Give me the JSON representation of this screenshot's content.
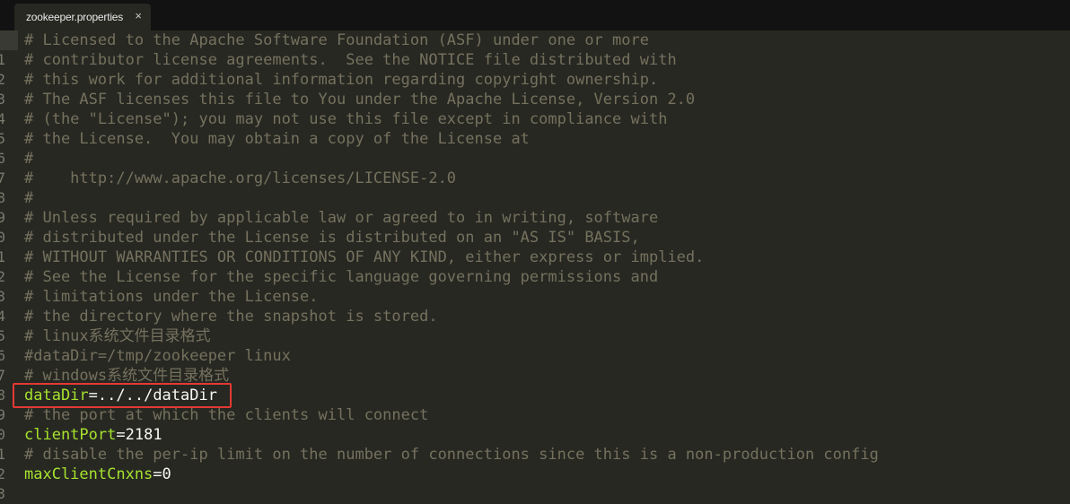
{
  "tab": {
    "title": "zookeeper.properties",
    "close_symbol": "×"
  },
  "colors": {
    "comment": "#75715e",
    "key": "#a6e22e",
    "value": "#f8f8f2",
    "highlight": "#e53935"
  },
  "lines": [
    {
      "type": "comment",
      "text": "# Licensed to the Apache Software Foundation (ASF) under one or more"
    },
    {
      "type": "comment",
      "text": "# contributor license agreements.  See the NOTICE file distributed with"
    },
    {
      "type": "comment",
      "text": "# this work for additional information regarding copyright ownership."
    },
    {
      "type": "comment",
      "text": "# The ASF licenses this file to You under the Apache License, Version 2.0"
    },
    {
      "type": "comment",
      "text": "# (the \"License\"); you may not use this file except in compliance with"
    },
    {
      "type": "comment",
      "text": "# the License.  You may obtain a copy of the License at"
    },
    {
      "type": "comment",
      "text": "#"
    },
    {
      "type": "comment",
      "text": "#    http://www.apache.org/licenses/LICENSE-2.0"
    },
    {
      "type": "comment",
      "text": "#"
    },
    {
      "type": "comment",
      "text": "# Unless required by applicable law or agreed to in writing, software"
    },
    {
      "type": "comment",
      "text": "# distributed under the License is distributed on an \"AS IS\" BASIS,"
    },
    {
      "type": "comment",
      "text": "# WITHOUT WARRANTIES OR CONDITIONS OF ANY KIND, either express or implied."
    },
    {
      "type": "comment",
      "text": "# See the License for the specific language governing permissions and"
    },
    {
      "type": "comment",
      "text": "# limitations under the License."
    },
    {
      "type": "comment",
      "text": "# the directory where the snapshot is stored."
    },
    {
      "type": "comment",
      "text": "# linux系统文件目录格式"
    },
    {
      "type": "comment",
      "text": "#dataDir=/tmp/zookeeper linux"
    },
    {
      "type": "comment",
      "text": "# windows系统文件目录格式"
    },
    {
      "type": "kv",
      "key": "dataDir",
      "value": "../../dataDir",
      "highlighted": true
    },
    {
      "type": "comment",
      "text": "# the port at which the clients will connect"
    },
    {
      "type": "kv",
      "key": "clientPort",
      "value": "2181"
    },
    {
      "type": "comment",
      "text": "# disable the per-ip limit on the number of connections since this is a non-production config"
    },
    {
      "type": "kv",
      "key": "maxClientCnxns",
      "value": "0"
    }
  ],
  "gutter": {
    "numbers": [
      "",
      "1",
      "2",
      "3",
      "4",
      "5",
      "6",
      "7",
      "8",
      "9",
      "0",
      "1",
      "2",
      "3",
      "4",
      "5",
      "6",
      "7",
      "8",
      "9",
      "0",
      "1",
      "2",
      "3"
    ]
  }
}
